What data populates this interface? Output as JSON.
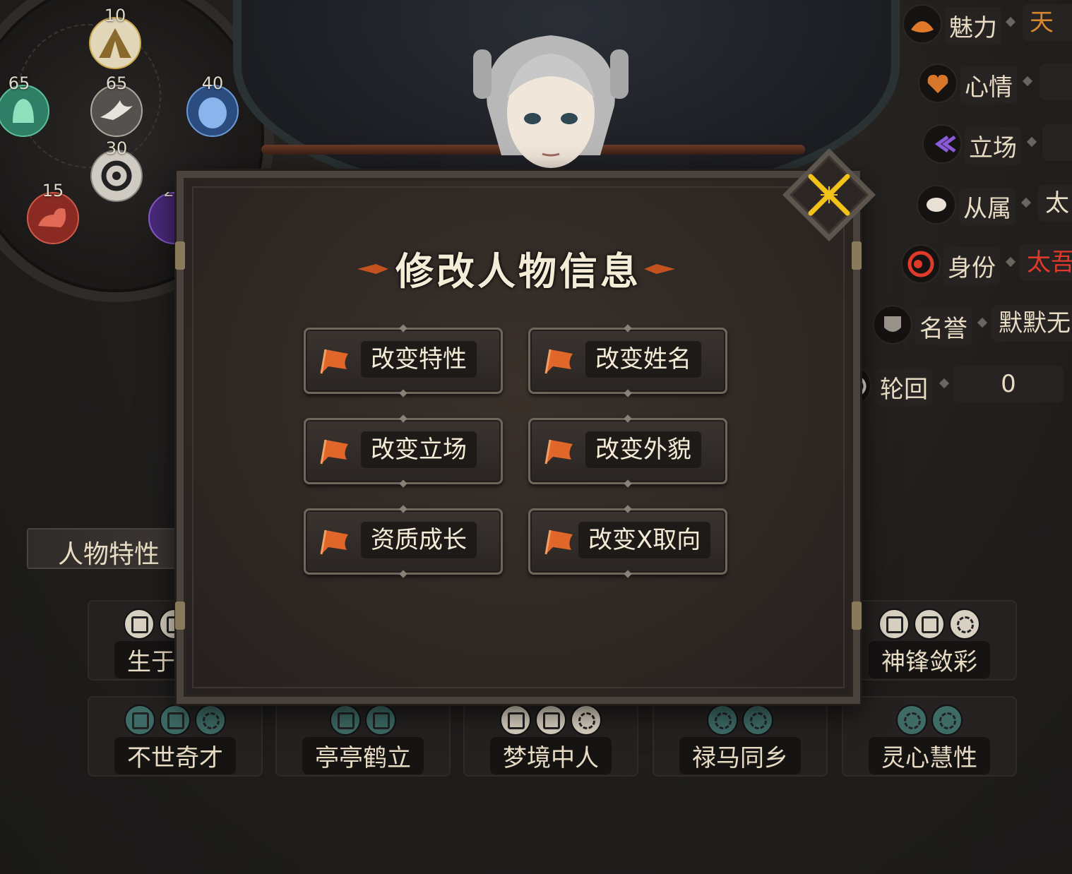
{
  "stats": [
    {
      "name": "tent",
      "value": "10"
    },
    {
      "name": "green-bell",
      "value": "65"
    },
    {
      "name": "swallow",
      "value": "65"
    },
    {
      "name": "blue-mask",
      "value": "40"
    },
    {
      "name": "knot",
      "value": "30"
    },
    {
      "name": "arm",
      "value": "15"
    },
    {
      "name": "purple",
      "value": "2"
    }
  ],
  "attributes": [
    {
      "label": "魅力",
      "value": "天",
      "value_color": "#d8872e"
    },
    {
      "label": "心情",
      "value": "",
      "value_color": "#e8dcc4"
    },
    {
      "label": "立场",
      "value": "",
      "value_color": "#e8dcc4"
    },
    {
      "label": "从属",
      "value": "太",
      "value_color": "#e8dcc4"
    },
    {
      "label": "身份",
      "value": "太吾",
      "value_color": "#e03a2a"
    },
    {
      "label": "名誉",
      "value": "默默无",
      "value_color": "#e8dcc4"
    },
    {
      "label": "轮回",
      "value": "0",
      "value_color": "#e8dcc4"
    }
  ],
  "trait_section_label": "人物特性",
  "trait_cards": [
    {
      "label": "生于",
      "icons": [
        "shield",
        "shield"
      ]
    },
    {
      "label": "神锋敛彩",
      "icons": [
        "sword",
        "shield",
        "swirl"
      ]
    },
    {
      "label": "不世奇才",
      "icons": [
        "sword",
        "shield",
        "swirl"
      ]
    },
    {
      "label": "亭亭鹤立",
      "icons": [
        "sword",
        "sword"
      ]
    },
    {
      "label": "梦境中人",
      "icons": [
        "sword",
        "shield",
        "swirl"
      ]
    },
    {
      "label": "禄马同乡",
      "icons": [
        "swirl",
        "swirl"
      ]
    },
    {
      "label": "灵心慧性",
      "icons": [
        "swirl",
        "swirl"
      ]
    }
  ],
  "modal": {
    "title": "修改人物信息",
    "buttons": [
      {
        "label": "改变特性"
      },
      {
        "label": "改变姓名"
      },
      {
        "label": "改变立场"
      },
      {
        "label": "改变外貌"
      },
      {
        "label": "资质成长"
      },
      {
        "label": "改变X取向"
      }
    ]
  },
  "colors": {
    "accent_orange": "#c4521e",
    "close_gold": "#f2c21a",
    "identity_red": "#e03a2a"
  }
}
